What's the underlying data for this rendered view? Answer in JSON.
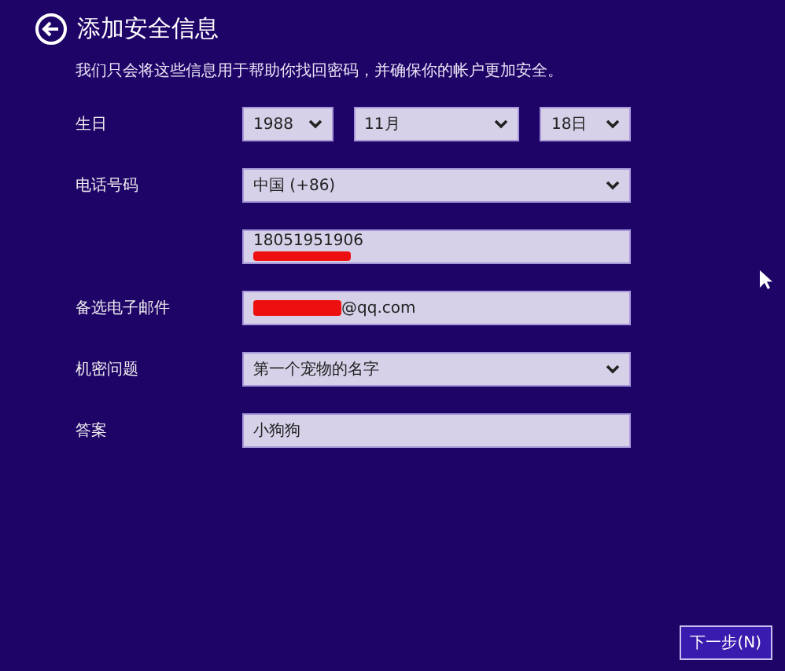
{
  "title": "添加安全信息",
  "subtitle": "我们只会将这些信息用于帮助你找回密码，并确保你的帐户更加安全。",
  "fields": [
    {
      "kind": "dates",
      "label": "生日",
      "parts": [
        {
          "value": "1988",
          "kind": "short"
        },
        {
          "value": "11月",
          "kind": "long"
        },
        {
          "value": "18日",
          "kind": "short"
        }
      ]
    },
    {
      "kind": "dropdown",
      "label": "电话号码",
      "value": "中国 (+86)"
    },
    {
      "kind": "masked",
      "value": "18051951906"
    },
    {
      "kind": "redacted",
      "label": "备选电子邮件",
      "value": "@qq.com"
    },
    {
      "kind": "dropdown",
      "label": "机密问题",
      "value": "第一个宠物的名字"
    },
    {
      "kind": "text",
      "label": "答案",
      "value": "小狗狗"
    }
  ],
  "next_button": "下一步(N)"
}
